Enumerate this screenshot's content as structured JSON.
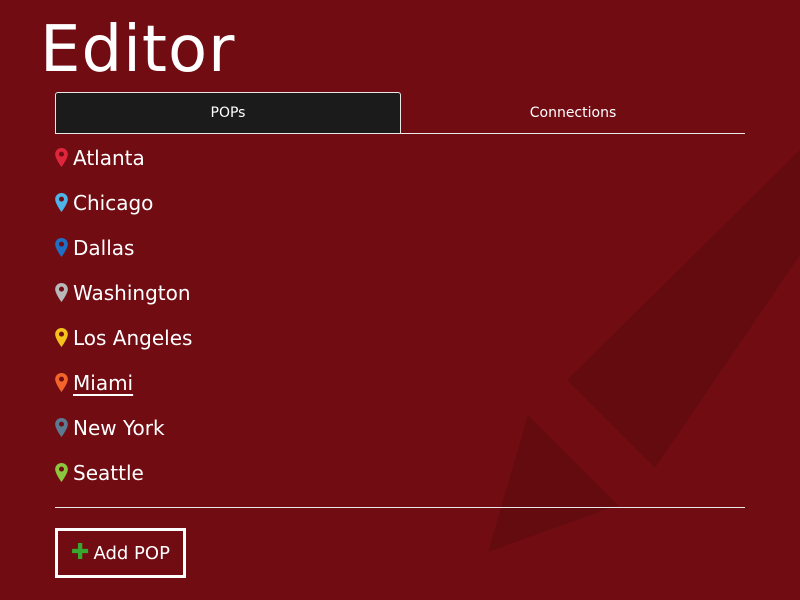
{
  "header": {
    "title": "Editor"
  },
  "tabs": [
    {
      "label": "POPs",
      "active": true
    },
    {
      "label": "Connections",
      "active": false
    }
  ],
  "pops": [
    {
      "name": "Atlanta",
      "pin_color": "#e0263c",
      "underlined": false
    },
    {
      "name": "Chicago",
      "pin_color": "#4fb4e8",
      "underlined": false
    },
    {
      "name": "Dallas",
      "pin_color": "#1f6fc4",
      "underlined": false
    },
    {
      "name": "Washington",
      "pin_color": "#b8b8b8",
      "underlined": false
    },
    {
      "name": "Los Angeles",
      "pin_color": "#f5c21b",
      "underlined": false
    },
    {
      "name": "Miami",
      "pin_color": "#f2642a",
      "underlined": true
    },
    {
      "name": "New York",
      "pin_color": "#5d7a93",
      "underlined": false
    },
    {
      "name": "Seattle",
      "pin_color": "#8cc63f",
      "underlined": false
    }
  ],
  "actions": {
    "add_pop_label": "Add POP",
    "add_icon": "plus-icon"
  },
  "colors": {
    "background": "#710c13",
    "active_tab": "#1b1b1b",
    "plus_icon": "#37a82f"
  }
}
